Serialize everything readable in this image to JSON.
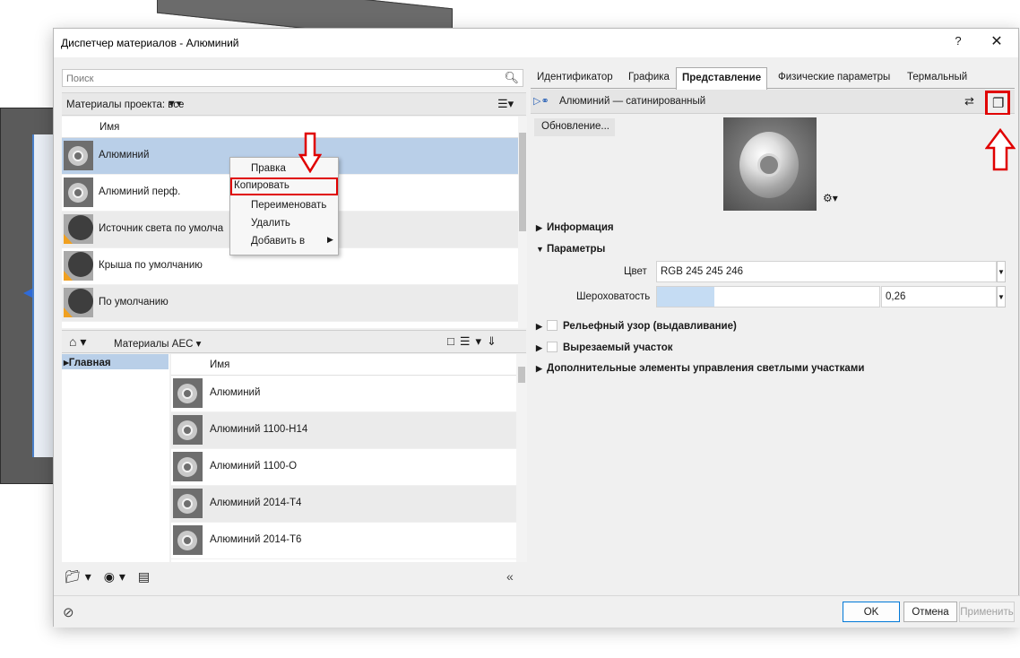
{
  "window": {
    "title": "Диспетчер материалов - Алюминий",
    "help": "?",
    "close": "✕"
  },
  "search": {
    "placeholder": "Поиск"
  },
  "project_materials": {
    "header_label": "Материалы проекта: все",
    "column_name": "Имя",
    "items": [
      {
        "name": "Алюминий",
        "type": "metal",
        "selected": true
      },
      {
        "name": "Алюминий перф.",
        "type": "metal"
      },
      {
        "name": "Источник света по умолча",
        "type": "default"
      },
      {
        "name": "Крыша по умолчанию",
        "type": "default"
      },
      {
        "name": "По умолчанию",
        "type": "default"
      }
    ]
  },
  "context_menu": {
    "items": [
      {
        "label": "Правка"
      },
      {
        "label": "Копировать",
        "highlighted": true
      },
      {
        "label": "Переименовать"
      },
      {
        "label": "Удалить"
      },
      {
        "label": "Добавить в",
        "submenu": true
      }
    ]
  },
  "library": {
    "breadcrumb": "Материалы AEC",
    "tree": [
      {
        "label": "Главная",
        "selected": true
      }
    ],
    "column_name": "Имя",
    "items": [
      {
        "name": "Алюминий"
      },
      {
        "name": "Алюминий 1100-H14"
      },
      {
        "name": "Алюминий 1100-O"
      },
      {
        "name": "Алюминий 2014-T4"
      },
      {
        "name": "Алюминий 2014-T6"
      }
    ]
  },
  "tabs": [
    {
      "label": "Идентификатор"
    },
    {
      "label": "Графика"
    },
    {
      "label": "Представление",
      "active": true
    },
    {
      "label": "Физические параметры"
    },
    {
      "label": "Термальный"
    }
  ],
  "asset": {
    "name": "Алюминий — сатинированный",
    "update_label": "Обновление..."
  },
  "sections": {
    "info": "Информация",
    "params": "Параметры",
    "relief": "Рельефный узор (выдавливание)",
    "cutout": "Вырезаемый участок",
    "extra": "Дополнительные элементы управления светлыми участками"
  },
  "params": {
    "color_label": "Цвет",
    "color_value": "RGB 245 245 246",
    "roughness_label": "Шероховатость",
    "roughness_value": "0,26",
    "roughness_fraction": 0.26
  },
  "buttons": {
    "ok": "OK",
    "cancel": "Отмена",
    "apply": "Применить"
  },
  "colors": {
    "selection": "#b9cfe8",
    "annotation": "#e00000",
    "ok_border": "#0078d7"
  }
}
